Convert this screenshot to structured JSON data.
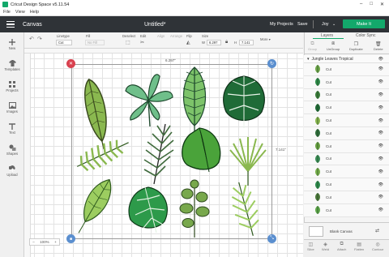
{
  "titlebar": {
    "title": "Cricut Design Space  v5.11.54",
    "minimize": "–",
    "maximize": "□",
    "close": "✕"
  },
  "menu": [
    "File",
    "View",
    "Help"
  ],
  "header": {
    "section": "Canvas",
    "project": "Untitled*",
    "my_projects": "My Projects",
    "save": "Save",
    "user": "Joy",
    "make_it": "Make It"
  },
  "toolbar": {
    "linetype_label": "Linetype",
    "linetype_value": "Cut",
    "fill_label": "Fill",
    "fill_value": "No Fill",
    "deselect": "Deselect",
    "edit": "Edit",
    "align": "Align",
    "arrange": "Arrange",
    "flip": "Flip",
    "size_label": "Size",
    "size_w_label": "W",
    "size_w": "6.297",
    "size_h_label": "H",
    "size_h": "7.141",
    "more": "More ▾"
  },
  "left_nav": [
    {
      "label": "New",
      "icon": "plus-icon"
    },
    {
      "label": "Templates",
      "icon": "shirt-icon"
    },
    {
      "label": "Projects",
      "icon": "grid-icon"
    },
    {
      "label": "Images",
      "icon": "image-icon"
    },
    {
      "label": "Text",
      "icon": "text-icon"
    },
    {
      "label": "Shapes",
      "icon": "shapes-icon"
    },
    {
      "label": "Upload",
      "icon": "upload-icon"
    }
  ],
  "canvas": {
    "width_dim": "6.297\"",
    "height_dim": "7.141\""
  },
  "panel": {
    "tab_layers": "Layers",
    "tab_color_sync": "Color Sync",
    "group_label": "Group",
    "ungroup_label": "UnGroup",
    "duplicate_label": "Duplicate",
    "delete_label": "Delete",
    "group_name": "Jungle Leaves Tropical",
    "layers": [
      {
        "name": "Cut",
        "color": "#6fa84a"
      },
      {
        "name": "Cut",
        "color": "#2e8b4a"
      },
      {
        "name": "Cut",
        "color": "#3a7d3a"
      },
      {
        "name": "Cut",
        "color": "#1f6b37"
      },
      {
        "name": "Cut",
        "color": "#8ab84f"
      },
      {
        "name": "Cut",
        "color": "#2f6e3c"
      },
      {
        "name": "Cut",
        "color": "#6aa343"
      },
      {
        "name": "Cut",
        "color": "#3b8f58"
      },
      {
        "name": "Cut",
        "color": "#78b04c"
      },
      {
        "name": "Cut",
        "color": "#2d8c4e"
      },
      {
        "name": "Cut",
        "color": "#4d7a3c"
      },
      {
        "name": "Cut",
        "color": "#5ea84a"
      }
    ],
    "blank_canvas": "Blank Canvas",
    "bottom": [
      "Slice",
      "Weld",
      "Attach",
      "Flatten",
      "Contour"
    ]
  },
  "zoom": {
    "minus": "–",
    "value": "100%",
    "plus": "+"
  },
  "colors": {
    "header": "#2f3337",
    "accent": "#13a86b",
    "handle_delete": "#d9414f",
    "handle_blue": "#5b8fcf"
  }
}
